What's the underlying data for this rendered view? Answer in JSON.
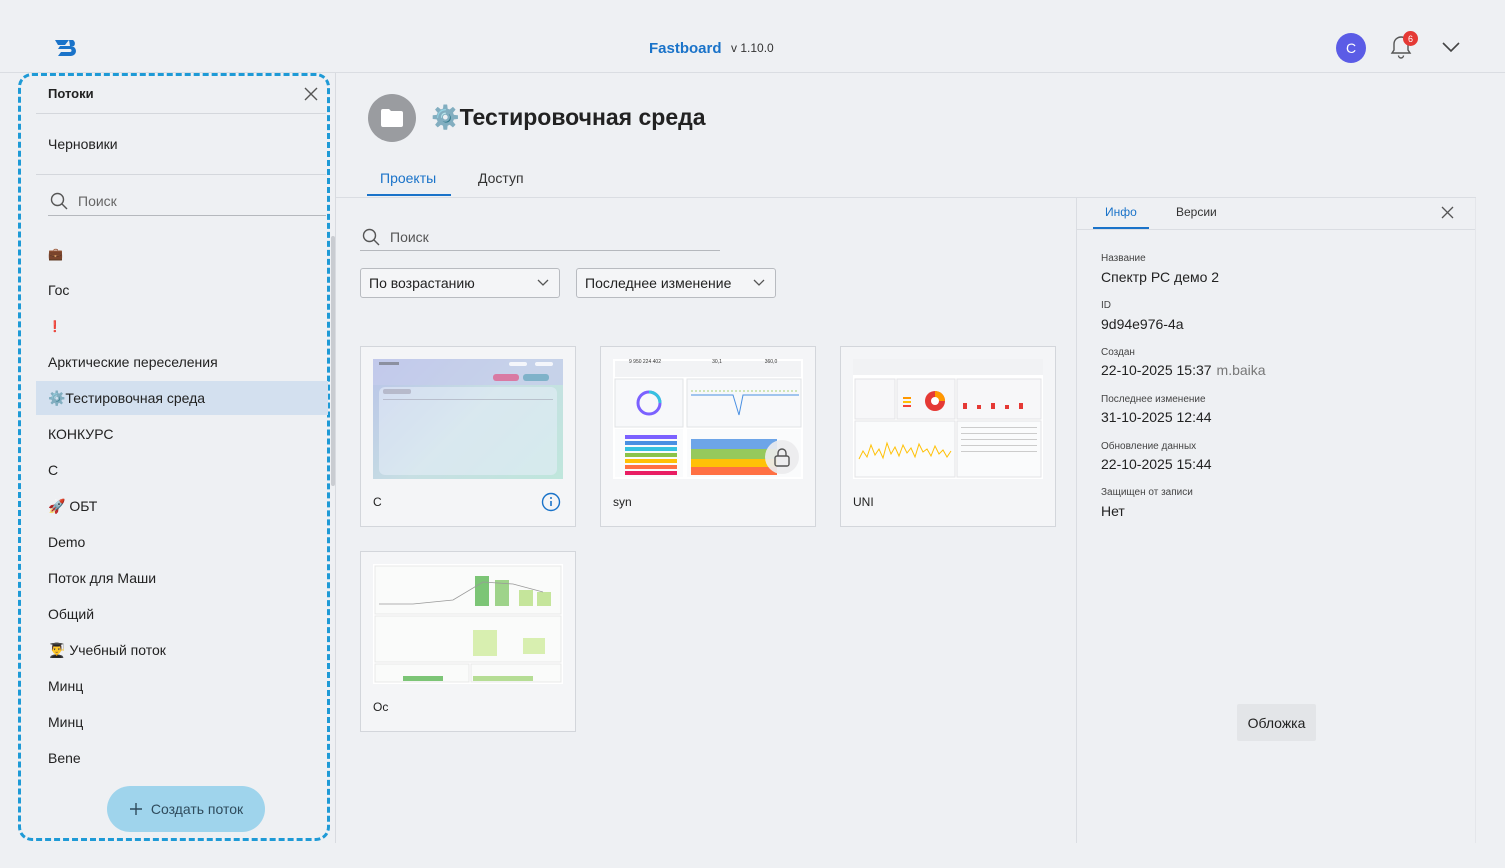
{
  "header": {
    "brand": "Fastboard",
    "version": "v 1.10.0",
    "avatar_letter": "С",
    "notifications_count": "6"
  },
  "sidebar": {
    "title": "Потоки",
    "drafts": "Черновики",
    "search_placeholder": "Поиск",
    "items": [
      {
        "label": "💼"
      },
      {
        "label": "Гос"
      },
      {
        "label": "❗"
      },
      {
        "label": "Арктические переселения"
      },
      {
        "label": "⚙️Тестировочная среда"
      },
      {
        "label": "КОНКУРС"
      },
      {
        "label": "С"
      },
      {
        "label": "🚀 ОБТ"
      },
      {
        "label": "Demo"
      },
      {
        "label": "Поток для Маши"
      },
      {
        "label": "Общий"
      },
      {
        "label": "👨‍🎓 Учебный поток"
      },
      {
        "label": "Минц"
      },
      {
        "label": "Минц"
      },
      {
        "label": "Bene"
      }
    ],
    "active_index": 4,
    "create_button": "Создать поток"
  },
  "main": {
    "title": "⚙️Тестировочная среда",
    "tabs": [
      "Проекты",
      "Доступ"
    ],
    "search_placeholder": "Поиск",
    "sort_order": "По возрастанию",
    "sort_field": "Последнее изменение",
    "projects": [
      {
        "name": "С",
        "locked": false,
        "info": true
      },
      {
        "name": "syn",
        "locked": true,
        "info": false
      },
      {
        "name": "UNI",
        "locked": false,
        "info": false
      },
      {
        "name": "Ос",
        "locked": false,
        "info": false
      }
    ],
    "thumb_numbers": [
      "9 950 224 402",
      "30,1",
      "360,0"
    ]
  },
  "info_panel": {
    "tabs": [
      "Инфо",
      "Версии"
    ],
    "fields": {
      "name_label": "Название",
      "name_value": "Спектр РС демо 2",
      "id_label": "ID",
      "id_value": "9d94e976-4a",
      "created_label": "Создан",
      "created_value": "22-10-2025 15:37",
      "created_by": "m.baika",
      "modified_label": "Последнее изменение",
      "modified_value": "31-10-2025 12:44",
      "data_update_label": "Обновление данных",
      "data_update_value": "22-10-2025 15:44",
      "protected_label": "Защищен от записи",
      "protected_value": "Нет"
    },
    "cover_button": "Обложка"
  },
  "colors": {
    "accent": "#1a73c9",
    "sidebar_border": "#1e9ad6",
    "active_item": "#d3e0ef",
    "create_button": "#9fd4ec",
    "avatar": "#5b5ce6",
    "badge": "#e53935"
  }
}
